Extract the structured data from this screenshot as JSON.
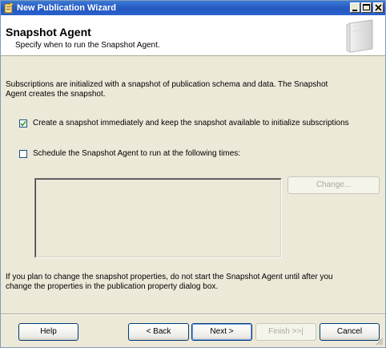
{
  "window": {
    "title": "New Publication Wizard",
    "controls": [
      "minimize-icon",
      "maximize-icon",
      "close-icon"
    ]
  },
  "header": {
    "title": "Snapshot Agent",
    "subtitle": "Specify when to run the Snapshot Agent."
  },
  "body": {
    "intro_line1": "Subscriptions are initialized with a snapshot of publication schema and data. The Snapshot",
    "intro_line2": "Agent creates the snapshot.",
    "create_snapshot": {
      "label": "Create a snapshot immediately and keep the snapshot available to initialize subscriptions",
      "checked": true
    },
    "schedule": {
      "label": "Schedule the Snapshot Agent to run at the following times:",
      "checked": false
    },
    "change_button": "Change...",
    "note_line1": "If you plan to change the snapshot properties, do not start the Snapshot Agent until after you",
    "note_line2": "change the properties in the publication property dialog box."
  },
  "footer": {
    "help": "Help",
    "back": "< Back",
    "next": "Next >",
    "finish": "Finish >>|",
    "cancel": "Cancel"
  }
}
